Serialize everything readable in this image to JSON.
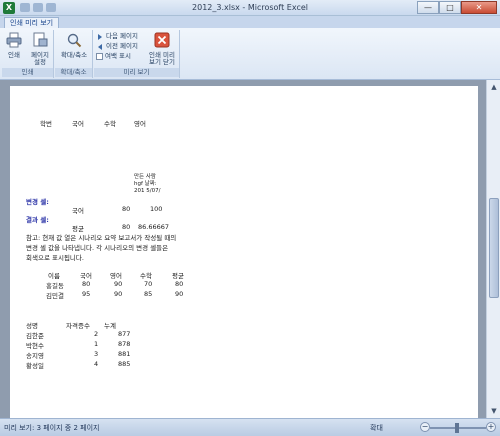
{
  "window": {
    "title": "2012_3.xlsx - Microsoft Excel",
    "minimize": "—",
    "maximize": "□",
    "close": "✕"
  },
  "tab": "인쇄 미리 보기",
  "ribbon": {
    "groups": {
      "print": "인쇄",
      "zoom": "확대/축소",
      "preview": "미리 보기"
    },
    "buttons": {
      "print": "인쇄",
      "page_setup_1": "페이지",
      "page_setup_2": "설정",
      "zoom": "확대/축소",
      "next_page": "다음 페이지",
      "prev_page": "이전 페이지",
      "show_margins": "여백 표시",
      "close_1": "인쇄 미리",
      "close_2": "보기 닫기"
    }
  },
  "sheet": {
    "header_row": [
      "학번",
      "국어",
      "수학",
      "영어"
    ],
    "note_lines": [
      "만든 사람",
      "hgf 날짜:",
      "201 5/07/"
    ],
    "changed_cells_label": "변경 셀:",
    "changed_row": {
      "label": "국어",
      "v1": "80",
      "v2": "100"
    },
    "result_cells_label": "결과 셀:",
    "result_row": {
      "label": "평균",
      "v1": "80",
      "v2": "86.66667"
    },
    "remark_lines": [
      "참고: 현재 값 열은 시나리오 요약 보고서가 작성될 때의",
      "변경 셀 값을 나타냅니다. 각 시나리오의 변경 셀들은",
      "회색으로 표시됩니다."
    ],
    "table1": {
      "headers": [
        "이름",
        "국어",
        "영어",
        "수학",
        "평균"
      ],
      "rows": [
        [
          "홍길동",
          "80",
          "90",
          "70",
          "80"
        ],
        [
          "김민결",
          "95",
          "90",
          "85",
          "90"
        ]
      ]
    },
    "table2": {
      "headers": [
        "성명",
        "자격증수",
        "누계"
      ],
      "rows": [
        [
          "김한준",
          "2",
          "877"
        ],
        [
          "박현수",
          "1",
          "878"
        ],
        [
          "송지영",
          "3",
          "881"
        ],
        [
          "황성일",
          "4",
          "885"
        ]
      ]
    }
  },
  "status": {
    "page_info": "미리 보기: 3 페이지 중 2 페이지",
    "zoom_label": "확대",
    "zoom_value": "",
    "zoom_minus": "−",
    "zoom_plus": "+"
  }
}
